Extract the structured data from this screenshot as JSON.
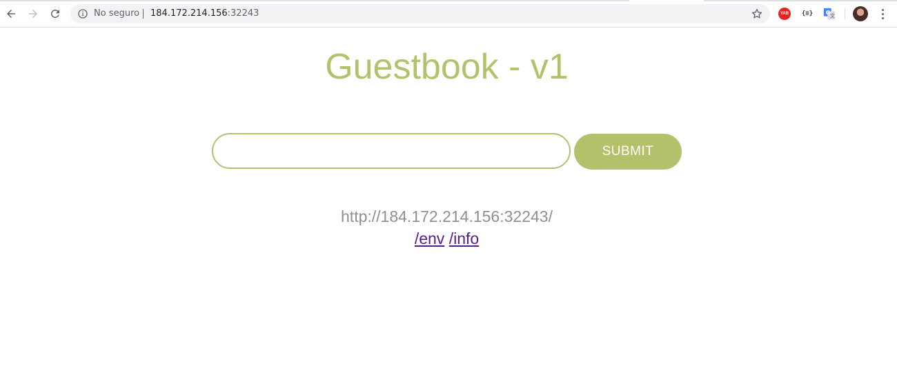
{
  "browser": {
    "security_label": "No seguro",
    "url_host": "184.172.214.156",
    "url_port": ":32243",
    "extensions": {
      "yab_label": "YAB",
      "json_label": "{≡}"
    },
    "icons": [
      "back-arrow-icon",
      "forward-arrow-icon",
      "reload-icon",
      "info-icon",
      "star-icon",
      "translate-icon",
      "menu-icon"
    ]
  },
  "page": {
    "title": "Guestbook - v1",
    "entry_value": "",
    "submit_label": "SUBMIT",
    "host_address": "http://184.172.214.156:32243/",
    "links": [
      {
        "label": "/env"
      },
      {
        "label": "/info"
      }
    ]
  },
  "colors": {
    "accent": "#b5c06b",
    "host_text": "#8f8f8f",
    "visited_link": "#551a8b"
  }
}
